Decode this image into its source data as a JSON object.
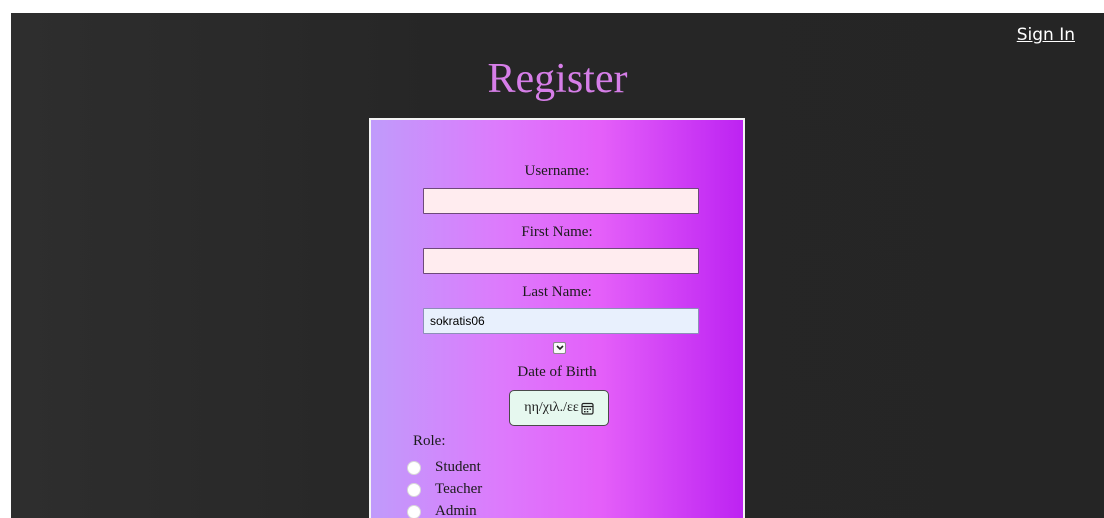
{
  "header": {
    "sign_in": "Sign In",
    "title": "Register"
  },
  "form": {
    "username_label": "Username:",
    "username_value": "",
    "first_name_label": "First Name:",
    "first_name_value": "",
    "last_name_label": "Last Name:",
    "last_name_value": "sokratis06",
    "dob_label": "Date of Birth",
    "dob_placeholder": "ηη/χιλ./εε",
    "role_label": "Role:",
    "roles": [
      "Student",
      "Teacher",
      "Admin"
    ]
  },
  "colors": {
    "title": "#d67ee8",
    "background": "#262626",
    "input_empty": "#ffecef",
    "input_filled": "#e8f0fd",
    "date_button": "#e6f8ef"
  },
  "icons": {
    "dropdown": "chevron-down-icon",
    "calendar": "calendar-icon"
  }
}
